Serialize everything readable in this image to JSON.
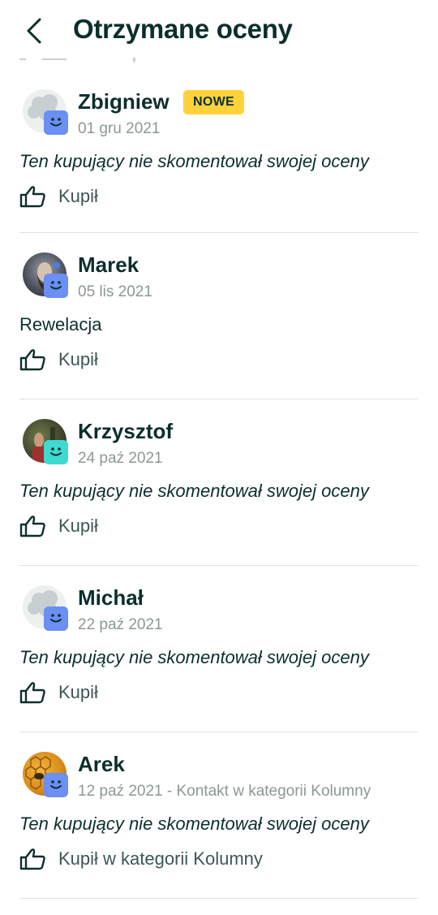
{
  "header": {
    "title": "Otrzymane oceny"
  },
  "reviews": [
    {
      "name": "Zbigniew",
      "badge": "NOWE",
      "date": "01 gru 2021",
      "comment": "Ten kupujący nie skomentował swojej oceny",
      "comment_italic": true,
      "footer": "Kupił",
      "avatar": "default-avatar",
      "badge_color": "#6b8ff2"
    },
    {
      "name": "Marek",
      "badge": "",
      "date": "05 lis 2021",
      "comment": "Rewelacja",
      "comment_italic": false,
      "footer": "Kupił",
      "avatar": "photo-avatar",
      "badge_color": "#6b8ff2"
    },
    {
      "name": "Krzysztof",
      "badge": "",
      "date": "24 paź 2021",
      "comment": "Ten kupujący nie skomentował swojej oceny",
      "comment_italic": true,
      "footer": "Kupił",
      "avatar": "photo-avatar",
      "badge_color": "#3fd9d0"
    },
    {
      "name": "Michał",
      "badge": "",
      "date": "22 paź 2021",
      "comment": "Ten kupujący nie skomentował swojej oceny",
      "comment_italic": true,
      "footer": "Kupił",
      "avatar": "default-avatar",
      "badge_color": "#6b8ff2"
    },
    {
      "name": "Arek",
      "badge": "",
      "date": "12 paź 2021 - Kontakt w kategorii Kolumny",
      "comment": "Ten kupujący nie skomentował swojej oceny",
      "comment_italic": true,
      "footer": "Kupił w kategorii Kolumny",
      "avatar": "photo-avatar",
      "badge_color": "#6b8ff2"
    }
  ]
}
